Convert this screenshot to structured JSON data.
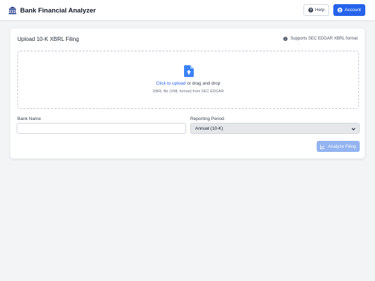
{
  "header": {
    "title": "Bank Financial Analyzer",
    "brand_icon": "bank-icon",
    "help_label": "Help",
    "help_icon": "question-circle-icon",
    "account_label": "Account",
    "account_icon": "user-circle-icon"
  },
  "upload_card": {
    "title": "Upload 10-K XBRL Filing",
    "note": "Supports SEC EDGAR XBRL format",
    "note_icon": "info-circle-icon",
    "dropzone": {
      "icon": "file-upload-icon",
      "link_text": "Click to upload",
      "rest_text": " or drag and drop",
      "hint": "XBRL file (XML format) from SEC EDGAR"
    },
    "bank_name": {
      "label": "Bank Name",
      "value": "",
      "placeholder": ""
    },
    "reporting_period": {
      "label": "Reporting Period",
      "selected": "Annual (10-K)"
    },
    "analyze_label": "Analyze Filing",
    "analyze_icon": "chart-line-icon"
  },
  "colors": {
    "accent": "#2563eb",
    "analyze_disabled": "#93b4f0",
    "page_background": "#f3f4f6",
    "icon_dark": "#1f3a8a"
  }
}
